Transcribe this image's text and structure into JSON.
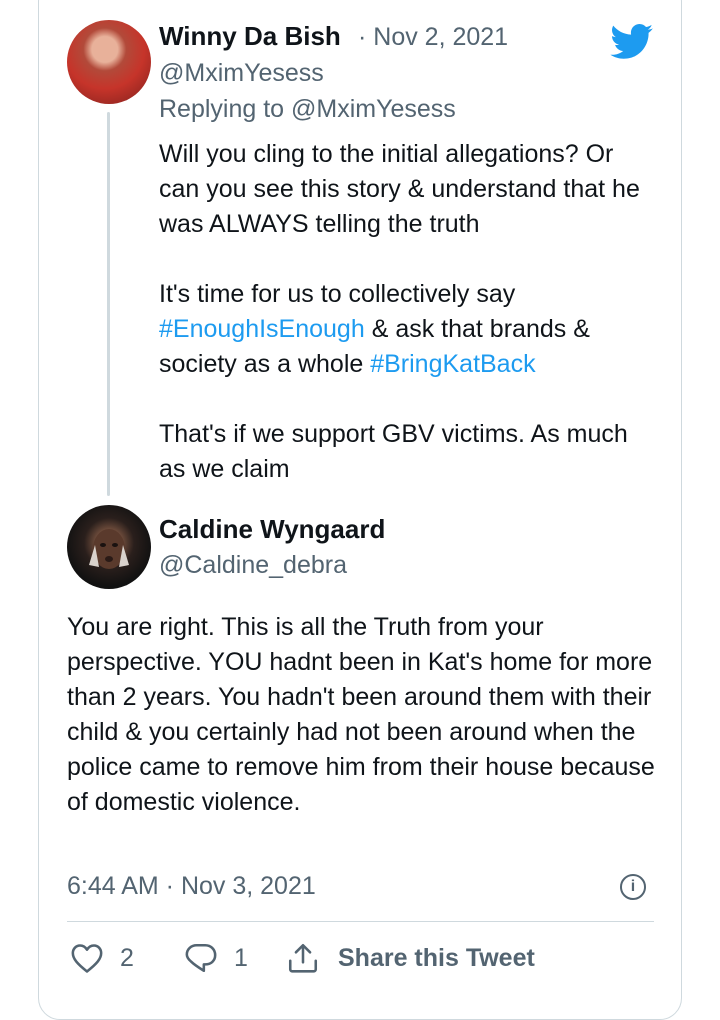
{
  "parent_tweet": {
    "author_name": "Winny Da Bish",
    "date": "· Nov 2, 2021",
    "handle": "@MximYesess",
    "replying_to": "Replying to @MximYesess",
    "p1": "Will you cling to the initial allegations? Or can you see this story & understand that he was ALWAYS telling the truth",
    "p2_pre": "It's time for us to collectively say ",
    "hashtag1": "#EnoughIsEnough",
    "p2_mid": " & ask that brands & society as a whole ",
    "hashtag2": "#BringKatBack",
    "p3": "That's if we support GBV victims. As much as we claim"
  },
  "main_tweet": {
    "author_name": "Caldine Wyngaard",
    "handle": "@Caldine_debra",
    "text": "You are right. This is all the Truth from your perspective. YOU hadnt been in Kat's home for more than 2 years. You hadn't been around them with their child & you certainly had not been around when the police came to remove him from their house because of domestic violence.",
    "timestamp": "6:44 AM · Nov 3, 2021",
    "info_glyph": "i"
  },
  "actions": {
    "like_count": "2",
    "reply_count": "1",
    "share_label": "Share this Tweet"
  },
  "colors": {
    "brand": "#1d9bf0",
    "muted": "#536471",
    "border": "#cfd9de"
  },
  "icons": [
    "twitter-bird-icon",
    "heart-icon",
    "reply-icon",
    "share-icon",
    "info-icon"
  ]
}
